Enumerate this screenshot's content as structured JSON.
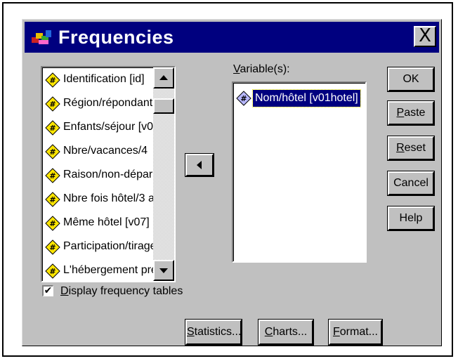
{
  "window": {
    "title": "Frequencies",
    "close_symbol": "X"
  },
  "source_list": {
    "items": [
      "Identification [id]",
      "Région/répondant",
      "Enfants/séjour [v0",
      "Nbre/vacances/4",
      "Raison/non-dépar",
      "Nbre fois hôtel/3 a",
      "Même hôtel [v07]",
      "Participation/tirage",
      "L'hébergement préf"
    ]
  },
  "move_button": {
    "icon": "arrow-left-icon"
  },
  "target": {
    "label_prefix": "",
    "label_mnemonic": "V",
    "label_rest": "ariable(s):",
    "items": [
      "Nom/hôtel [v01hotel]"
    ]
  },
  "buttons": {
    "ok": "OK",
    "paste": {
      "m": "P",
      "rest": "aste"
    },
    "reset": {
      "m": "R",
      "rest": "eset"
    },
    "cancel": "Cancel",
    "help": "Help",
    "statistics": {
      "m": "S",
      "rest": "tatistics..."
    },
    "charts": {
      "m": "C",
      "rest": "harts..."
    },
    "format": {
      "m": "F",
      "rest": "ormat..."
    }
  },
  "checkbox": {
    "checked": true,
    "mark": "✔",
    "label_mnemonic": "D",
    "label_rest": "isplay frequency tables"
  },
  "colors": {
    "title_bar": "#00007f",
    "dialog_face": "#c0c0c0",
    "selection": "#00007f"
  }
}
